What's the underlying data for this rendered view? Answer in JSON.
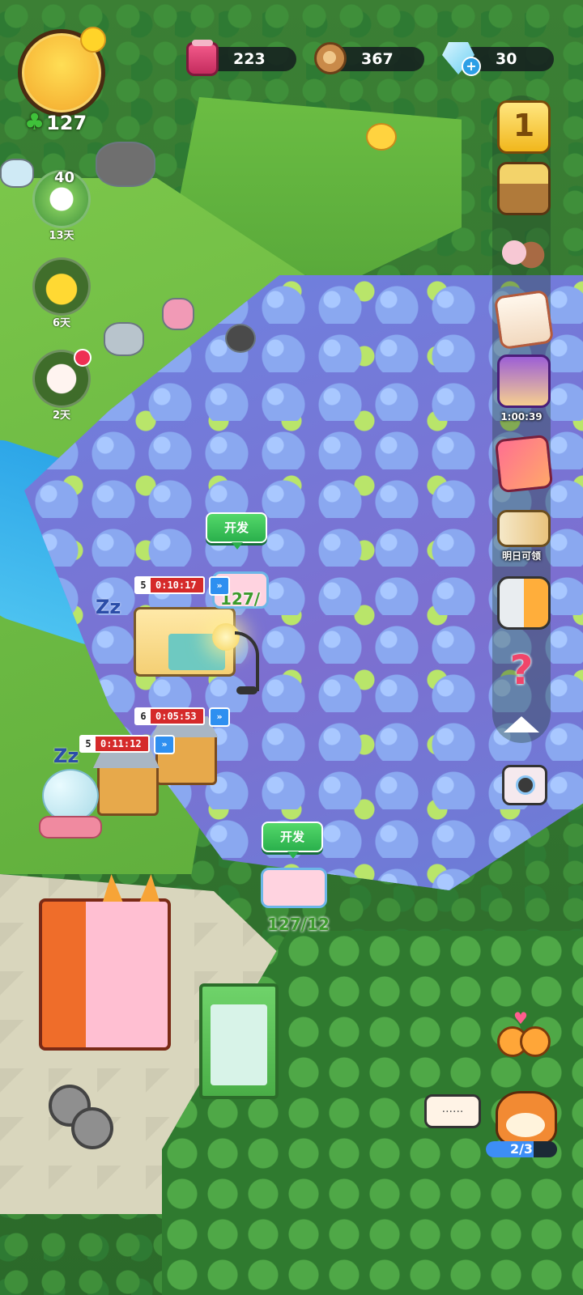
{
  "resources": {
    "jam": "223",
    "wood": "367",
    "gems": "30",
    "gems_plus": "+"
  },
  "player": {
    "clover_icon": "♣",
    "clover_count": "127"
  },
  "left_events": [
    {
      "level": "40",
      "days": "13天"
    },
    {
      "days": "6天"
    },
    {
      "days": "2天"
    }
  ],
  "right_rail": {
    "first_place_glyph": "1",
    "event_timer": "1:00:39",
    "tomorrow_label": "明日可领",
    "help_glyph": "?"
  },
  "timers": [
    {
      "level": "5",
      "time": "0:10:17"
    },
    {
      "level": "6",
      "time": "0:05:53"
    },
    {
      "level": "5",
      "time": "0:11:12"
    }
  ],
  "speedup_glyph": "»",
  "develop": [
    {
      "label": "开发",
      "progress": "127/"
    },
    {
      "label": "开发",
      "progress": "127/12"
    }
  ],
  "sleep_glyph": "Zz",
  "chat_bubble": "......",
  "cat_progress": {
    "text": "2/3",
    "fraction": 0.67
  },
  "heart_glyph": "♥",
  "colors": {
    "develop_green": "#2ab04c",
    "timer_red": "#d52a2a",
    "speed_blue": "#2e8ff0",
    "rail_bg": "rgba(30,60,40,0.35)"
  },
  "icons": [
    "jam-jar-icon",
    "wood-log-icon",
    "diamond-icon",
    "first-place-icon",
    "treasure-chest-icon",
    "friends-icon",
    "newspaper-icon",
    "girl-event-icon",
    "cards-icon",
    "ticket-icon",
    "fridge-buddies-icon",
    "help-icon",
    "camera-icon",
    "couple-icon",
    "cat-icon"
  ]
}
